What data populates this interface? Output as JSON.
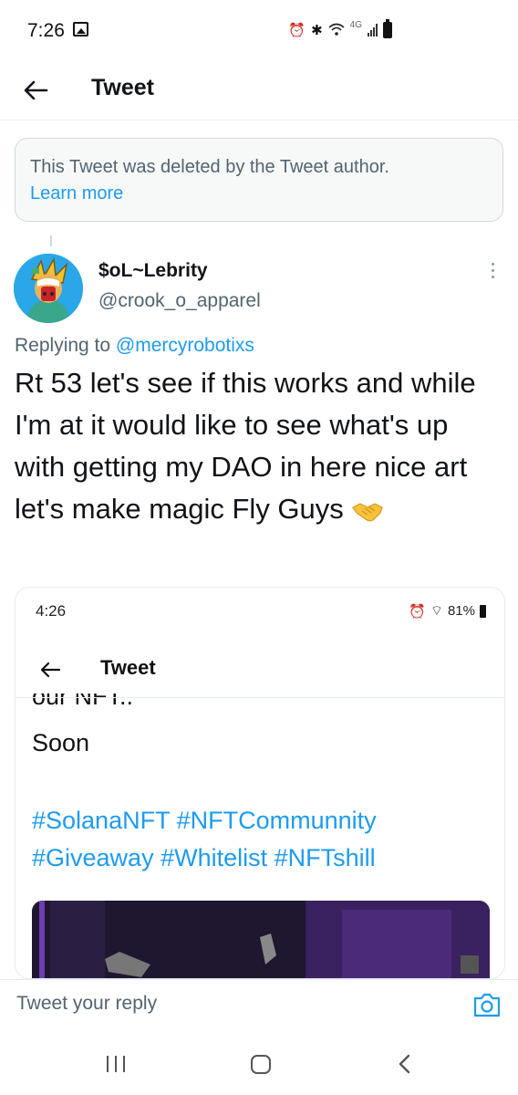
{
  "status_bar": {
    "time": "7:26",
    "icons": [
      "gallery-icon",
      "alarm-icon",
      "bluetooth-icon",
      "wifi-icon",
      "signal-icon",
      "battery-icon"
    ],
    "network": "4G"
  },
  "header": {
    "title": "Tweet"
  },
  "deleted_notice": {
    "text": "This Tweet was deleted by the Tweet author.",
    "link": "Learn more"
  },
  "tweet": {
    "display_name": "$oL~Lebrity",
    "handle": "@crook_o_apparel",
    "replying_prefix": "Replying to",
    "replying_to": "@mercyrobotixs",
    "text": "Rt 53 let's see if this works and while I'm at it would like to see what's up with getting my DAO in here nice art let's make magic Fly Guys",
    "emoji": "handshake-icon"
  },
  "embedded_screenshot": {
    "time": "4:26",
    "battery": "81%",
    "title": "Tweet",
    "cut_text": "our NFT..",
    "line": "Soon",
    "hashtags_line1": "#SolanaNFT #NFTCommunnity",
    "hashtags_line2": "#Giveaway #Whitelist #NFTshill"
  },
  "reply_bar": {
    "placeholder": "Tweet your reply"
  },
  "colors": {
    "accent": "#1d9bf0",
    "secondary_text": "#536471",
    "border": "#cfd9de"
  }
}
